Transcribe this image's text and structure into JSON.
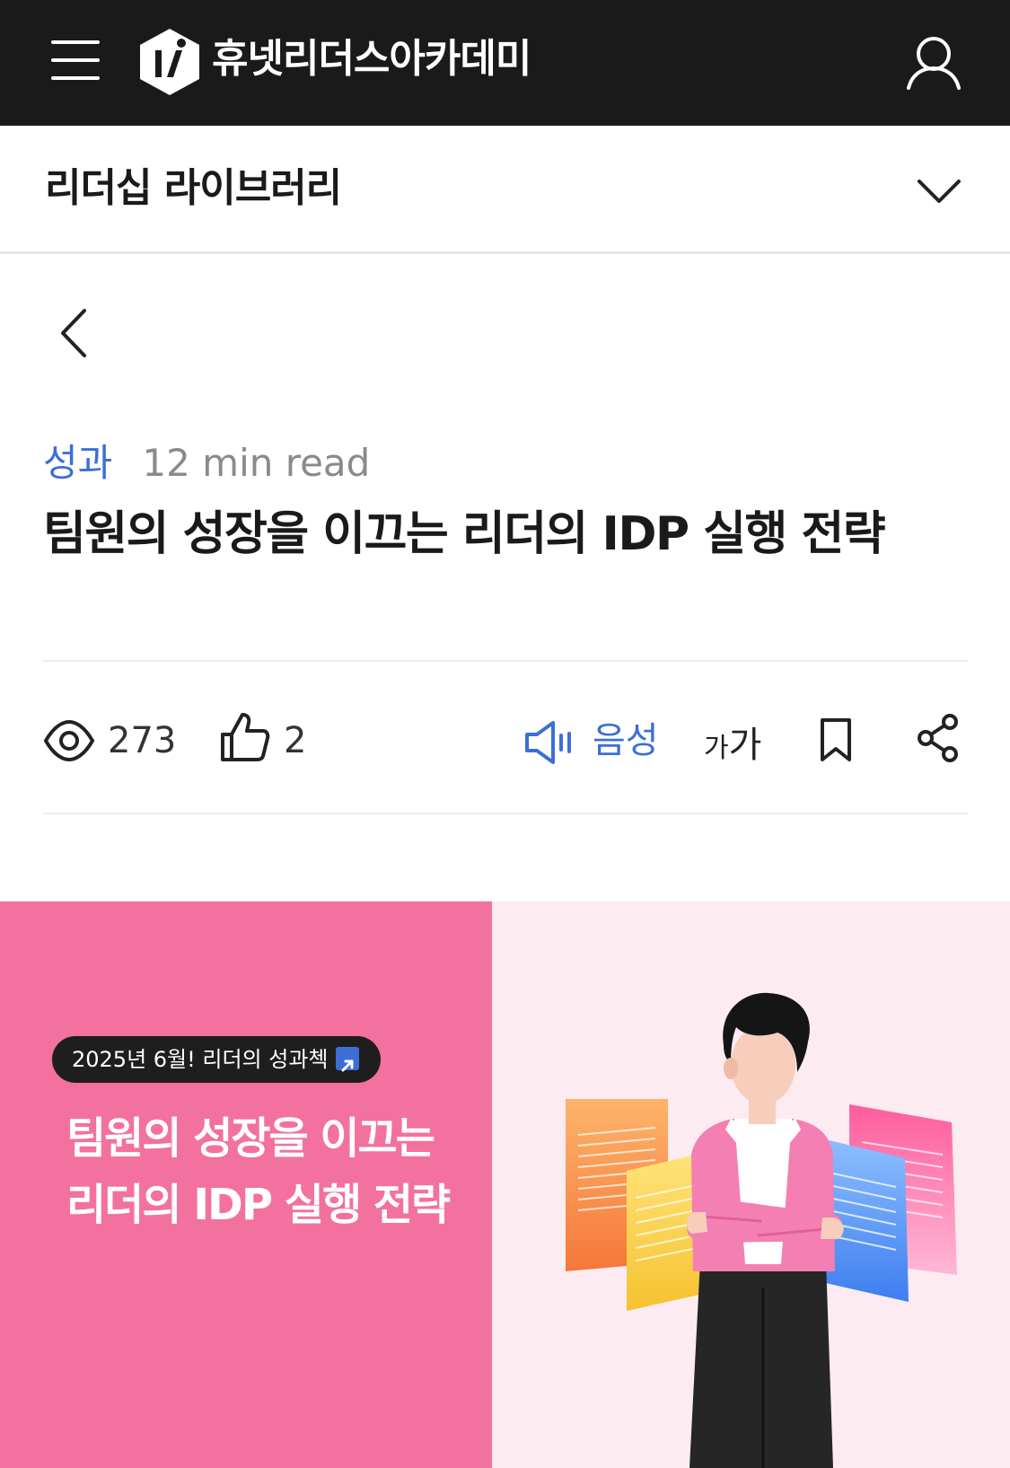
{
  "header": {
    "brand_name": "휴넷리더스아카데미",
    "logo_letter": "i"
  },
  "section": {
    "title": "리더십 라이브러리"
  },
  "article": {
    "category": "성과",
    "read_time": "12 min read",
    "title": "팀원의 성장을 이끄는 리더의 IDP 실행 전략"
  },
  "stats": {
    "views": "273",
    "likes": "2",
    "voice_label": "음성",
    "font_size_small": "가",
    "font_size_large": "가"
  },
  "hero": {
    "badge": "2025년 6월! 리더의 성과첵",
    "title_line1": "팀원의 성장을 이끄는",
    "title_line2": "리더의 IDP 실행 전략"
  },
  "colors": {
    "topbar": "#1a1a1a",
    "accent_blue": "#3c6fd6",
    "hero_pink": "#f3719f",
    "hero_light": "#fcebf1"
  },
  "icons": [
    "menu-icon",
    "logo-icon",
    "user-icon",
    "chevron-down-icon",
    "back-arrow-icon",
    "eye-icon",
    "thumbs-up-icon",
    "speaker-icon",
    "bookmark-icon",
    "share-icon"
  ]
}
